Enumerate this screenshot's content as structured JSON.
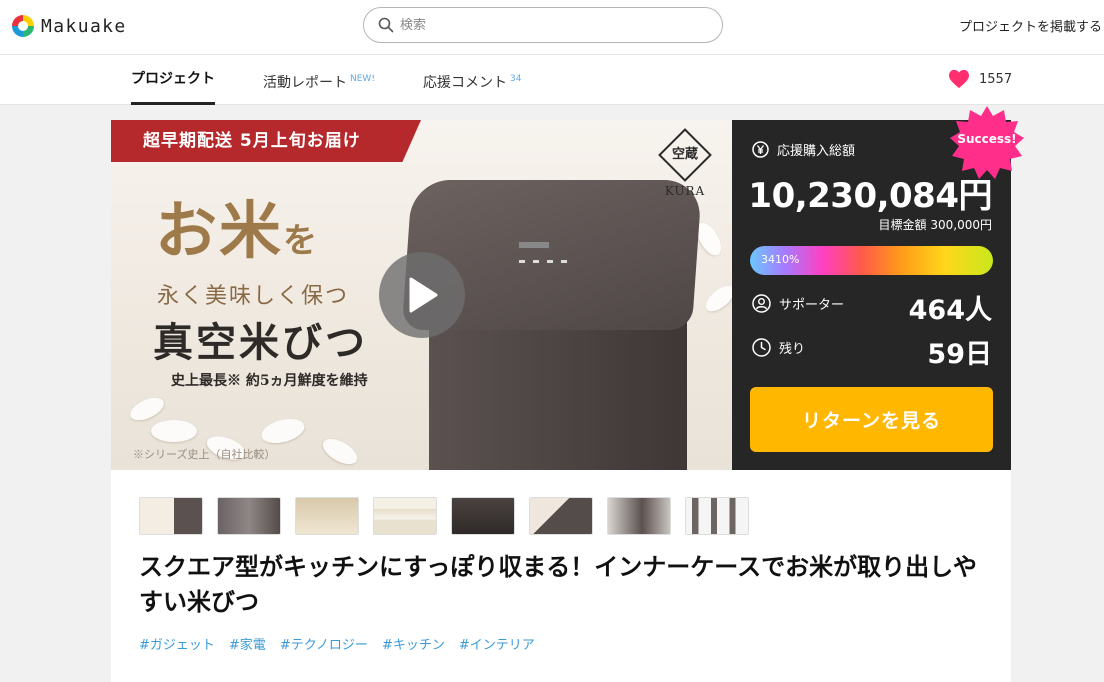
{
  "header": {
    "brand": "Makuake",
    "search_placeholder": "検索",
    "post_project_link": "プロジェクトを掲載する"
  },
  "tabs": [
    {
      "label": "プロジェクト",
      "badge": ""
    },
    {
      "label": "活動レポート",
      "badge": "NEW!"
    },
    {
      "label": "応援コメント",
      "badge": "34"
    }
  ],
  "likes": {
    "count": "1557"
  },
  "hero": {
    "ribbon": "超早期配送 5月上旬お届け",
    "headline_big": "お米",
    "headline_particle": "を",
    "headline_line2": "永く美味しく保つ",
    "headline_line3": "真空米びつ",
    "subline": "史上最長※ 約5ヵ月鮮度を維持",
    "note": "※シリーズ史上（自社比較）",
    "brand_badge_kanji": "空蔵",
    "brand_badge_name": "KURA"
  },
  "stats": {
    "success_badge": "Success!",
    "amount_label": "応援購入総額",
    "amount": "10,230,084円",
    "goal": "目標金額 300,000円",
    "progress_text": "3410%",
    "progress_fraction": 1.0,
    "supporters_label": "サポーター",
    "supporters": "464人",
    "remaining_label": "残り",
    "remaining": "59日",
    "returns_button": "リターンを見る"
  },
  "project": {
    "title": "スクエア型がキッチンにすっぽり収まる！インナーケースでお米が取り出しやすい米びつ",
    "tags": [
      "#ガジェット",
      "#家電",
      "#テクノロジー",
      "#キッチン",
      "#インテリア"
    ]
  },
  "colors": {
    "accent_button": "#ffb700",
    "ribbon": "#b5282c",
    "stats_bg": "#262626",
    "success_badge": "#ff2e8a",
    "tag_link": "#3a9ad9",
    "heart": "#ff2e6e"
  }
}
